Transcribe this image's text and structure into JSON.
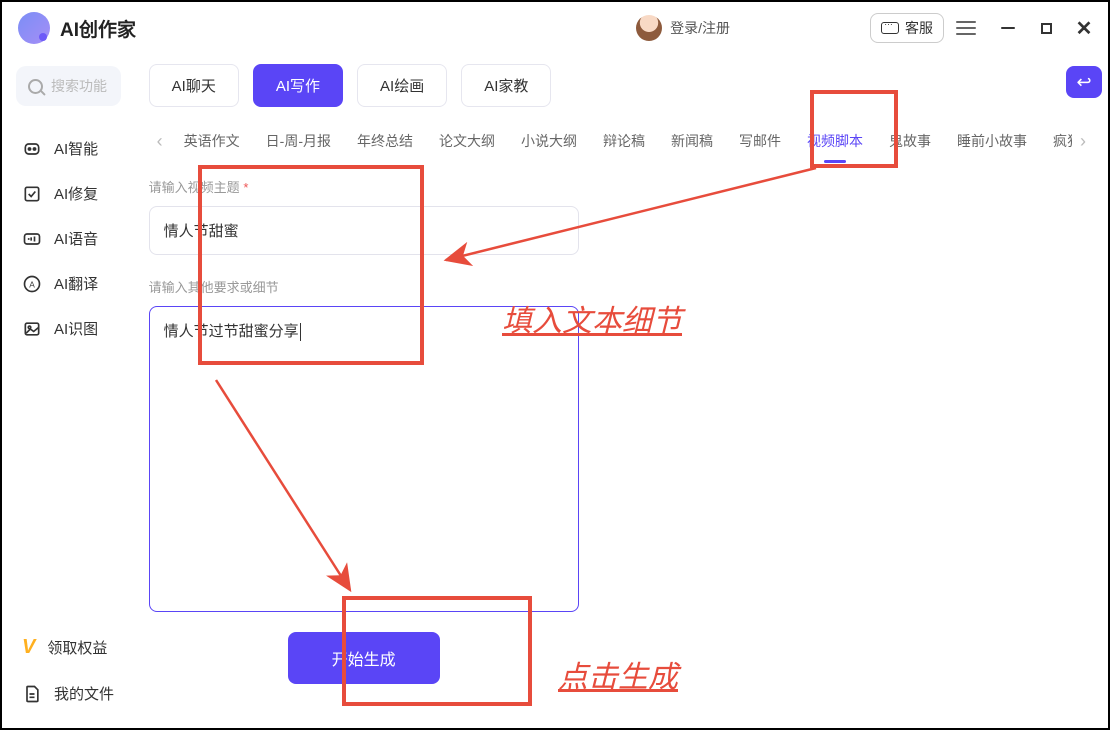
{
  "app_title": "AI创作家",
  "login_text": "登录/注册",
  "customer_service": "客服",
  "search_placeholder": "搜索功能",
  "sidebar": {
    "items": [
      {
        "label": "AI智能",
        "icon": "smart"
      },
      {
        "label": "AI修复",
        "icon": "repair"
      },
      {
        "label": "AI语音",
        "icon": "voice"
      },
      {
        "label": "AI翻译",
        "icon": "translate"
      },
      {
        "label": "AI识图",
        "icon": "image"
      }
    ],
    "claim_rights": "领取权益",
    "my_files": "我的文件"
  },
  "mode_tabs": [
    "AI聊天",
    "AI写作",
    "AI绘画",
    "AI家教"
  ],
  "mode_active": 1,
  "categories": [
    "英语作文",
    "日-周-月报",
    "年终总结",
    "论文大纲",
    "小说大纲",
    "辩论稿",
    "新闻稿",
    "写邮件",
    "视频脚本",
    "鬼故事",
    "睡前小故事",
    "疯狂"
  ],
  "category_active": 8,
  "form": {
    "topic_label": "请输入视频主题",
    "topic_required": "*",
    "topic_value": "情人节甜蜜",
    "detail_label": "请输入其他要求或细节",
    "detail_value": "情人节过节甜蜜分享",
    "generate_btn": "开始生成"
  },
  "annotations": {
    "fill_text": "填入文本细节",
    "click_gen": "点击生成"
  }
}
